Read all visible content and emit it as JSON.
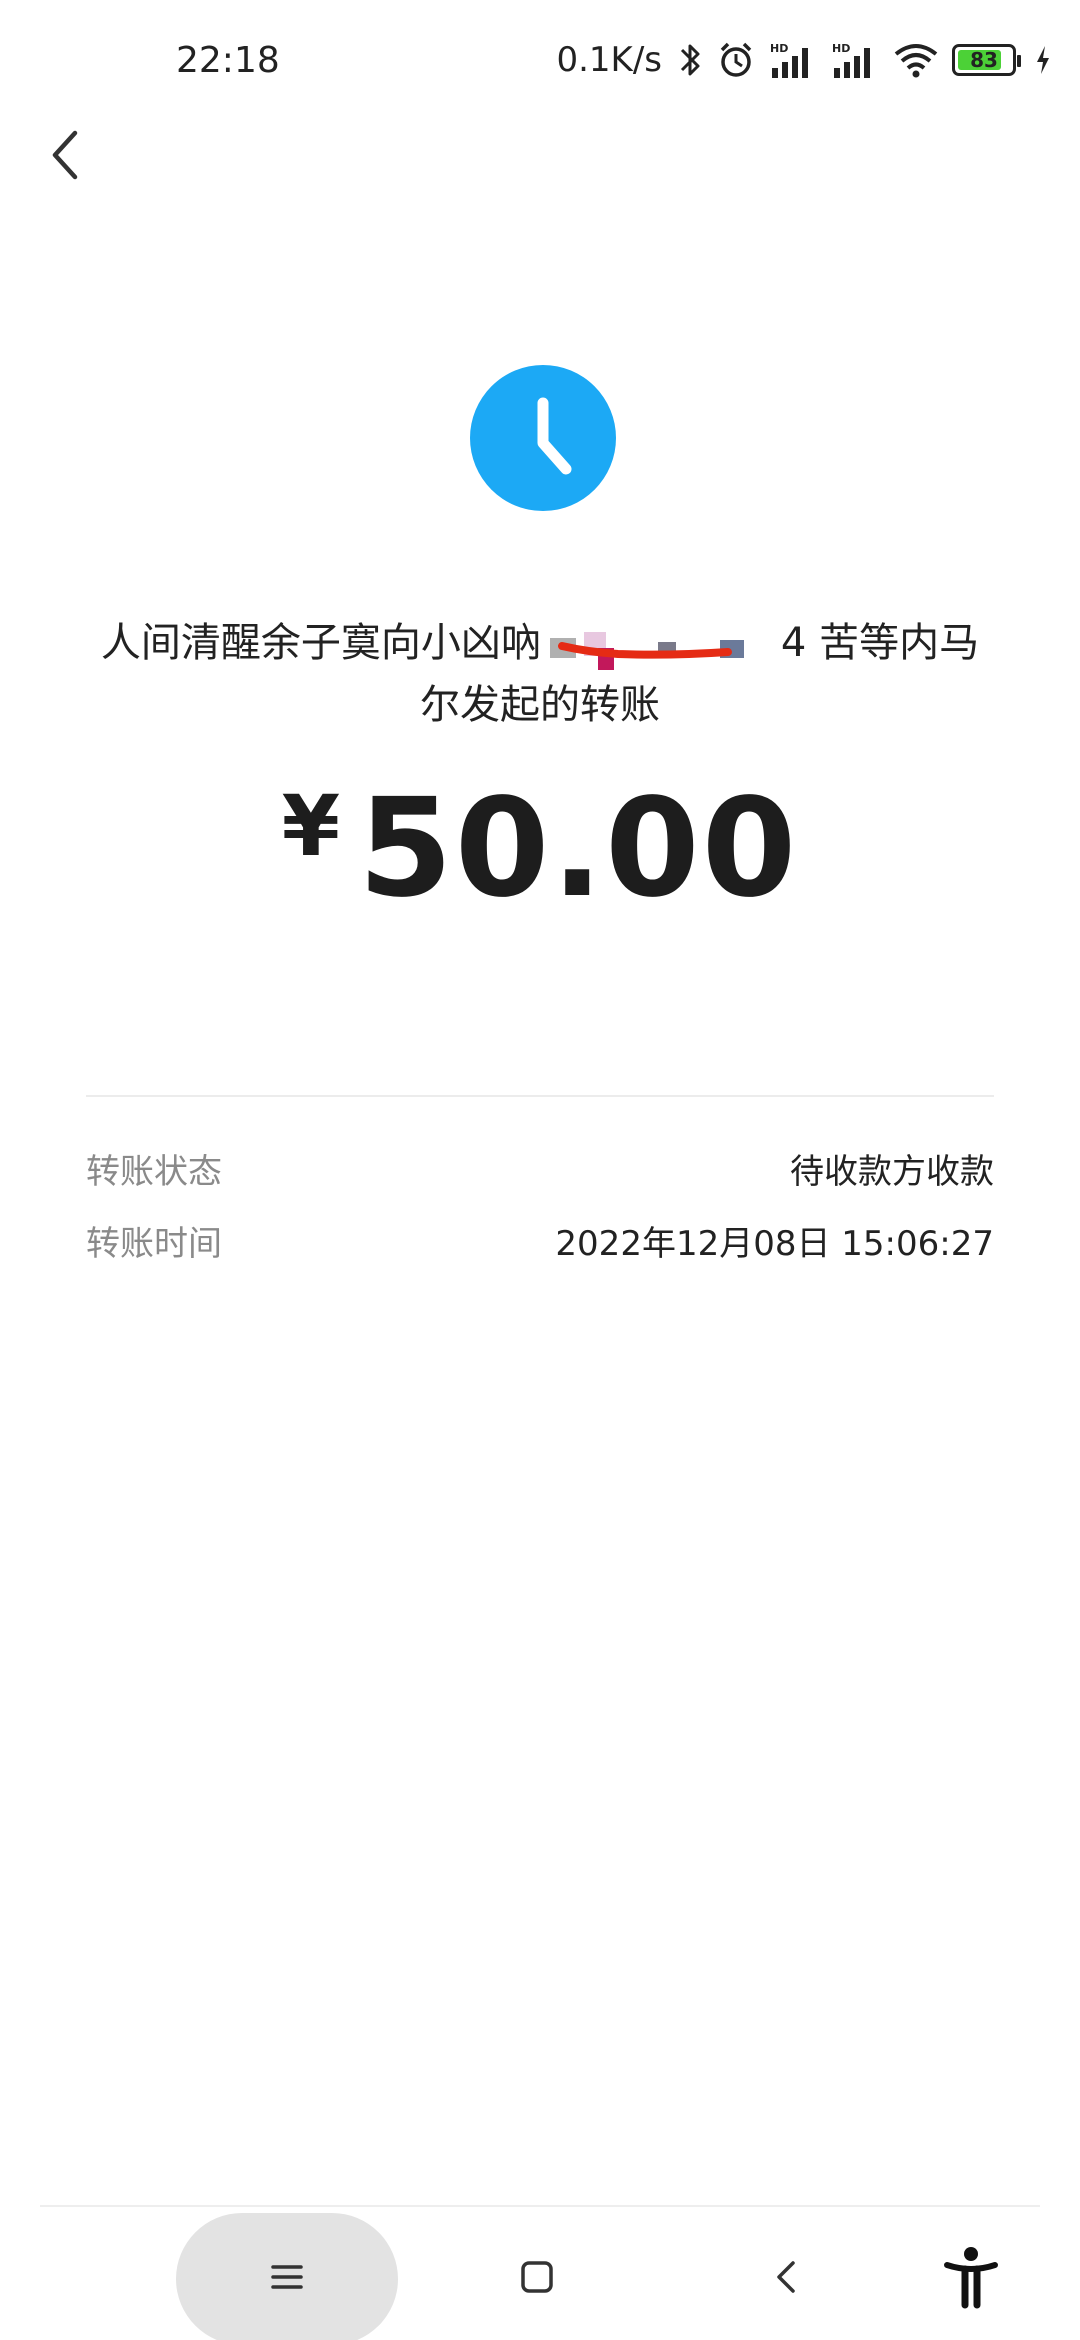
{
  "status_bar": {
    "time": "22:18",
    "speed": "0.1K/s",
    "battery_level": 83,
    "battery_label": "83",
    "signal_1_label": "HD",
    "signal_2_label": "HD",
    "icons": [
      "bluetooth-icon",
      "alarm-icon",
      "signal-icon",
      "signal-icon",
      "wifi-icon",
      "battery-icon",
      "charging-icon"
    ]
  },
  "header": {
    "back_icon": "chevron-left-icon"
  },
  "transfer": {
    "status_icon": "clock-icon",
    "status_color": "#1ca9f5",
    "description_line1": "人间清醒余子寞向小凶吶",
    "description_suffix": "4 苦等内马",
    "description_line2": "尔发起的转账",
    "currency_symbol": "¥",
    "amount": "50.00"
  },
  "details": [
    {
      "label": "转账状态",
      "value": "待收款方收款"
    },
    {
      "label": "转账时间",
      "value": "2022年12月08日 15:06:27"
    }
  ],
  "navbar": {
    "icons": [
      "menu-icon",
      "home-icon",
      "back-icon",
      "accessibility-icon"
    ]
  }
}
